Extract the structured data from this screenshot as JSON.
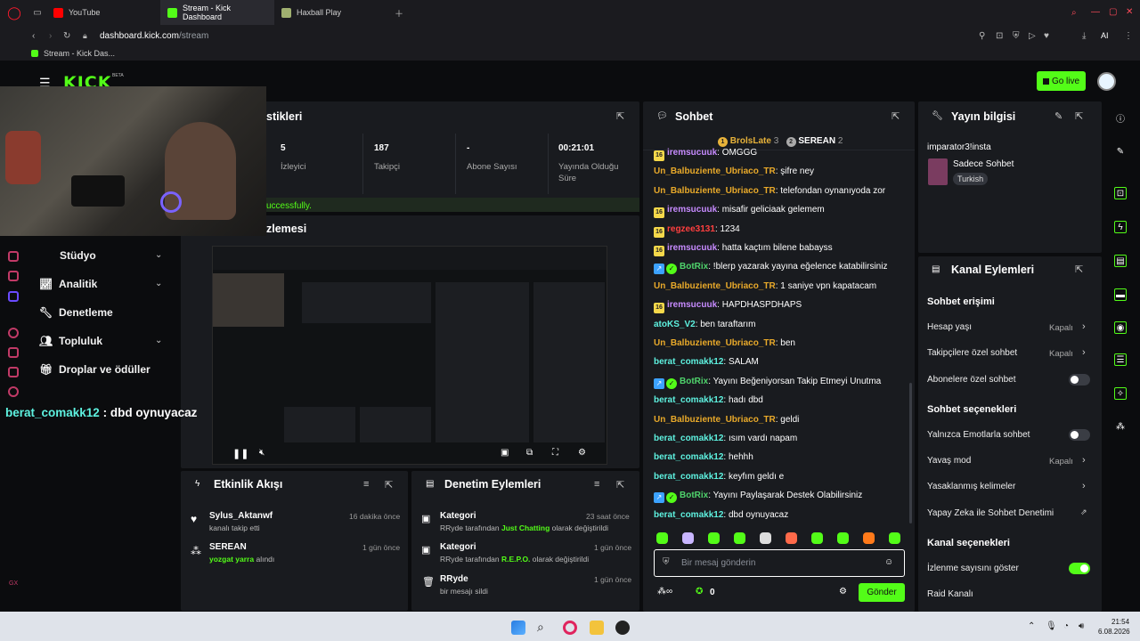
{
  "browser": {
    "tabs": [
      {
        "label": "YouTube",
        "color": "#ff0000"
      },
      {
        "label": "Stream - Kick Dashboard",
        "color": "#53fc18"
      },
      {
        "label": "Haxball Play",
        "color": "#a0b070"
      }
    ],
    "url_domain": "dashboard.kick.com",
    "url_path": "/stream",
    "bookmark": "Stream - Kick Das...",
    "ai_label": "AI"
  },
  "header": {
    "logo": "KICK",
    "beta": "BETA",
    "go_live": "Go live"
  },
  "overlay": {
    "chat_overlay_user": "berat_comakk12",
    "chat_overlay_msg": " : dbd oynuyacaz"
  },
  "stats": {
    "title_partial": "stikleri",
    "items": [
      {
        "value": "5",
        "label": "İzleyici"
      },
      {
        "value": "187",
        "label": "Takipçi"
      },
      {
        "value": "-",
        "label": "Abone Sayısı"
      },
      {
        "value": "00:21:01",
        "label": "Yayında Olduğu Süre"
      }
    ],
    "status_partial": "uccessfully."
  },
  "preview": {
    "title_partial": "zlemesi"
  },
  "sidebar": {
    "items": [
      {
        "label": "Stüdyo",
        "chevron": true
      },
      {
        "label": "Analitik",
        "chevron": true
      },
      {
        "label": "Denetleme",
        "chevron": false
      },
      {
        "label": "Topluluk",
        "chevron": true
      },
      {
        "label": "Droplar ve ödüller",
        "chevron": false
      }
    ]
  },
  "chat": {
    "title": "Sohbet",
    "top1_name": "BrolsLate",
    "top1_count": "3",
    "top2_name": "SEREAN",
    "top2_count": "2",
    "messages": [
      {
        "badge": "16",
        "user": "iremsucuuk",
        "color": "purple",
        "text": ": OMGGG"
      },
      {
        "badge": "",
        "user": "Un_Balbuziente_Ubriaco_TR",
        "color": "orange",
        "text": ": şifre ney"
      },
      {
        "badge": "",
        "user": "Un_Balbuziente_Ubriaco_TR",
        "color": "orange",
        "text": ": telefondan oynanıyoda zor"
      },
      {
        "badge": "16",
        "user": "iremsucuuk",
        "color": "purple",
        "text": ": misafir geliciaak gelemem"
      },
      {
        "badge": "16",
        "user": "regzee3131",
        "color": "red",
        "text": ": 1234"
      },
      {
        "badge": "16",
        "user": "iremsucuuk",
        "color": "purple",
        "text": ": hatta kaçtım bilene babayss"
      },
      {
        "badge": "bot",
        "user": "BotRix",
        "color": "green",
        "text": ": !blerp yazarak yayına eğelence katabilirsiniz"
      },
      {
        "badge": "",
        "user": "Un_Balbuziente_Ubriaco_TR",
        "color": "orange",
        "text": ": 1 saniye vpn kapatacam"
      },
      {
        "badge": "16",
        "user": "iremsucuuk",
        "color": "purple",
        "text": ": HAPDHASPDHAPS"
      },
      {
        "badge": "",
        "user": "atoKS_V2",
        "color": "cyan",
        "text": ": ben taraftarım"
      },
      {
        "badge": "",
        "user": "Un_Balbuziente_Ubriaco_TR",
        "color": "orange",
        "text": ": ben"
      },
      {
        "badge": "",
        "user": "berat_comakk12",
        "color": "cyan",
        "text": ": SALAM"
      },
      {
        "badge": "bot",
        "user": "BotRix",
        "color": "green",
        "text": ": Yayını Beğeniyorsan Takip Etmeyi Unutma"
      },
      {
        "badge": "",
        "user": "berat_comakk12",
        "color": "cyan",
        "text": ": hadı dbd"
      },
      {
        "badge": "",
        "user": "Un_Balbuziente_Ubriaco_TR",
        "color": "orange",
        "text": ": geldi"
      },
      {
        "badge": "",
        "user": "berat_comakk12",
        "color": "cyan",
        "text": ": ısım vardı napam"
      },
      {
        "badge": "",
        "user": "berat_comakk12",
        "color": "cyan",
        "text": ": hehhh"
      },
      {
        "badge": "",
        "user": "berat_comakk12",
        "color": "cyan",
        "text": ": keyfım geldı e"
      },
      {
        "badge": "bot",
        "user": "BotRix",
        "color": "green",
        "text": ": Yayını Paylaşarak Destek Olabilirsiniz"
      },
      {
        "badge": "",
        "user": "berat_comakk12",
        "color": "cyan",
        "text": ": dbd oynuyacaz"
      }
    ],
    "placeholder": "Bir mesaj gönderin",
    "points": "0",
    "send": "Gönder"
  },
  "stream_info": {
    "title": "Yayın bilgisi",
    "stream_title": "imparator3!insta",
    "category": "Sadece Sohbet",
    "language": "Turkish"
  },
  "channel_actions": {
    "title": "Kanal Eylemleri",
    "chat_access": "Sohbet erişimi",
    "account_age": "Hesap yaşı",
    "account_age_val": "Kapalı",
    "followers_only": "Takipçilere özel sohbet",
    "followers_only_val": "Kapalı",
    "subs_only": "Abonelere özel sohbet",
    "chat_options": "Sohbet seçenekleri",
    "emote_only": "Yalnızca Emotlarla sohbet",
    "slow_mode": "Yavaş mod",
    "slow_mode_val": "Kapalı",
    "banned_words": "Yasaklanmış kelimeler",
    "ai_moderation": "Yapay Zeka ile Sohbet Denetimi",
    "channel_options": "Kanal seçenekleri",
    "show_views": "İzlenme sayısını göster",
    "raid": "Raid Kanalı"
  },
  "activity": {
    "title": "Etkinlik Akışı",
    "items": [
      {
        "name": "Sylus_Aktanwf",
        "sub": "kanalı takip etti",
        "sub_hl": "",
        "time": "16 dakika önce"
      },
      {
        "name": "SEREAN",
        "sub": "alındı",
        "sub_hl": "yozgat yarra",
        "time": "1 gün önce"
      }
    ]
  },
  "moderation": {
    "title": "Denetim Eylemleri",
    "items": [
      {
        "name": "Kategori",
        "pre": "RRyde tarafından ",
        "hl": "Just Chatting",
        "post": " olarak değiştirildi",
        "time": "23 saat önce"
      },
      {
        "name": "Kategori",
        "pre": "RRyde tarafından ",
        "hl": "R.E.P.O.",
        "post": " olarak değiştirildi",
        "time": "1 gün önce"
      },
      {
        "name": "RRyde",
        "pre": "bir mesajı sildi",
        "hl": "",
        "post": "",
        "time": "1 gün önce"
      }
    ]
  },
  "taskbar": {
    "time": "21:54",
    "date": "6.08.2026",
    "gx": "GX"
  }
}
